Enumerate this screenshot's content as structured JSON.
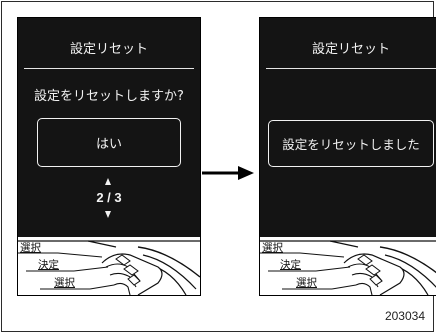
{
  "left_screen": {
    "title": "設定リセット",
    "question": "設定をリセットしますか?",
    "option": "はい",
    "pager": "2 / 3"
  },
  "right_screen": {
    "title": "設定リセット",
    "message": "設定をリセットしました"
  },
  "controls": {
    "select_top": "選択",
    "enter": "決定",
    "select_bottom": "選択"
  },
  "figure_code": "203034"
}
